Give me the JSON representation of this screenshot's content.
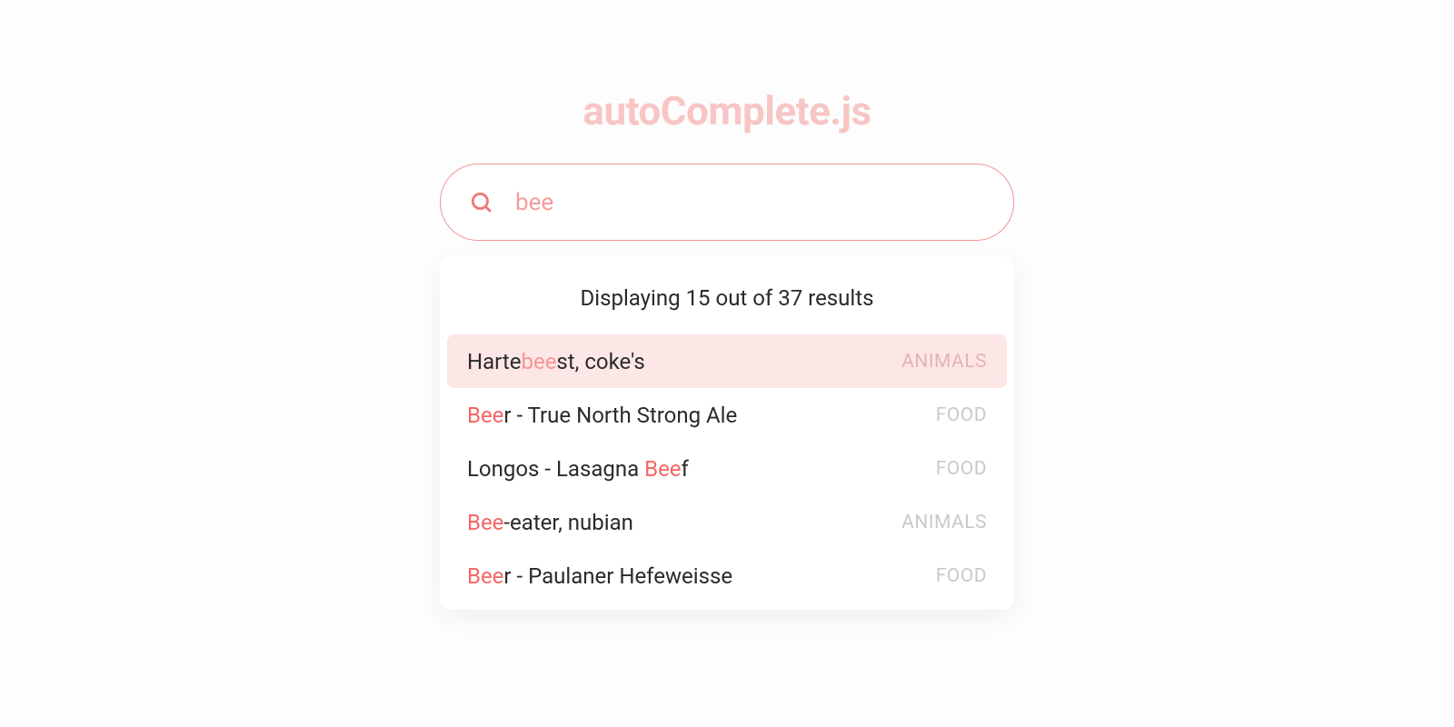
{
  "title": "autoComplete.js",
  "search": {
    "value": "bee",
    "placeholder": ""
  },
  "results": {
    "header": {
      "prefix": "Displaying ",
      "shown": "15",
      "middle": " out of ",
      "total": "37",
      "suffix": " results"
    },
    "items": [
      {
        "pre": "Harte",
        "match": "bee",
        "post": "st, coke's",
        "category": "ANIMALS",
        "highlighted": true
      },
      {
        "pre": "",
        "match": "Bee",
        "post": "r - True North Strong Ale",
        "category": "FOOD",
        "highlighted": false
      },
      {
        "pre": "Longos - Lasagna ",
        "match": "Bee",
        "post": "f",
        "category": "FOOD",
        "highlighted": false
      },
      {
        "pre": "",
        "match": "Bee",
        "post": "-eater, nubian",
        "category": "ANIMALS",
        "highlighted": false
      },
      {
        "pre": "",
        "match": "Bee",
        "post": "r - Paulaner Hefeweisse",
        "category": "FOOD",
        "highlighted": false
      }
    ]
  },
  "colors": {
    "accent": "#f56565",
    "accent_light": "#f8c5c5",
    "border": "#f59595",
    "highlight_bg": "#fde6e6"
  }
}
